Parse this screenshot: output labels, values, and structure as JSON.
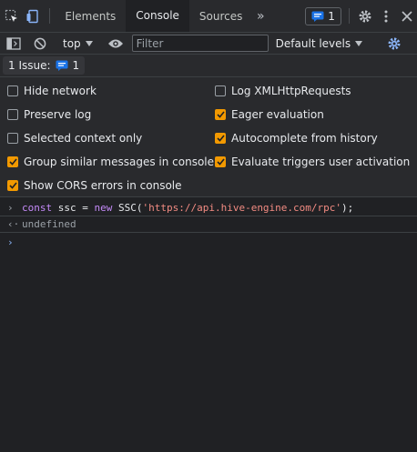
{
  "tabs": {
    "items": [
      {
        "label": "Elements"
      },
      {
        "label": "Console"
      },
      {
        "label": "Sources"
      }
    ],
    "more_icon": "double-chevron-right-icon",
    "issues_count": "1"
  },
  "toolbar": {
    "context": "top",
    "filter_placeholder": "Filter",
    "levels": "Default levels"
  },
  "issuebar": {
    "label": "1 Issue:",
    "count": "1"
  },
  "settings": {
    "items": [
      {
        "label": "Hide network",
        "checked": false
      },
      {
        "label": "Log XMLHttpRequests",
        "checked": false
      },
      {
        "label": "Preserve log",
        "checked": false
      },
      {
        "label": "Eager evaluation",
        "checked": true
      },
      {
        "label": "Selected context only",
        "checked": false
      },
      {
        "label": "Autocomplete from history",
        "checked": true
      },
      {
        "label": "Group similar messages in console",
        "checked": true
      },
      {
        "label": "Evaluate triggers user activation",
        "checked": true
      },
      {
        "label": "Show CORS errors in console",
        "checked": true
      }
    ]
  },
  "console": {
    "input_parts": {
      "kw1": "const",
      "mid": " ssc = ",
      "kw2": "new",
      "call": " SSC(",
      "str": "'https://api.hive-engine.com/rpc'",
      "end": ");"
    },
    "output": "undefined"
  },
  "colors": {
    "accent": "#8ab4f8",
    "checkbox_on": "#f29900",
    "badge_blue": "#1a73e8"
  }
}
